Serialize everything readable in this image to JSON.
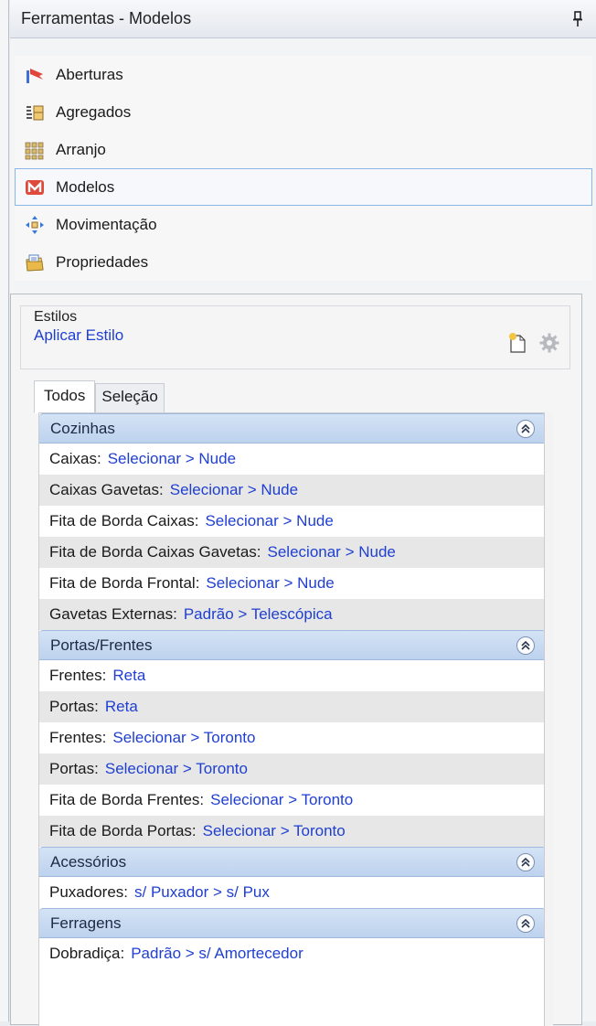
{
  "panel": {
    "title": "Ferramentas - Modelos"
  },
  "nav": [
    {
      "label": "Aberturas",
      "icon": "aberturas-icon"
    },
    {
      "label": "Agregados",
      "icon": "agregados-icon"
    },
    {
      "label": "Arranjo",
      "icon": "arranjo-icon"
    },
    {
      "label": "Modelos",
      "icon": "modelos-icon",
      "active": true
    },
    {
      "label": "Movimentação",
      "icon": "movimentacao-icon"
    },
    {
      "label": "Propriedades",
      "icon": "propriedades-icon"
    }
  ],
  "estilos": {
    "header": "Estilos",
    "link": "Aplicar Estilo"
  },
  "tabs": {
    "todos": "Todos",
    "selecao": "Seleção"
  },
  "groups": [
    {
      "title": "Cozinhas",
      "rows": [
        {
          "key": "Caixas:",
          "value": "Selecionar > Nude"
        },
        {
          "key": "Caixas Gavetas:",
          "value": "Selecionar > Nude"
        },
        {
          "key": "Fita de Borda Caixas:",
          "value": "Selecionar > Nude"
        },
        {
          "key": "Fita de Borda Caixas Gavetas:",
          "value": "Selecionar > Nude"
        },
        {
          "key": "Fita de Borda Frontal:",
          "value": "Selecionar > Nude"
        },
        {
          "key": "Gavetas Externas:",
          "value": "Padrão > Telescópica"
        }
      ]
    },
    {
      "title": "Portas/Frentes",
      "rows": [
        {
          "key": "Frentes:",
          "value": "Reta"
        },
        {
          "key": "Portas:",
          "value": "Reta"
        },
        {
          "key": "Frentes:",
          "value": "Selecionar > Toronto"
        },
        {
          "key": "Portas:",
          "value": "Selecionar > Toronto"
        },
        {
          "key": "Fita de Borda Frentes:",
          "value": "Selecionar > Toronto"
        },
        {
          "key": "Fita de Borda Portas:",
          "value": "Selecionar > Toronto"
        }
      ]
    },
    {
      "title": "Acessórios",
      "rows": [
        {
          "key": "Puxadores:",
          "value": "s/ Puxador > s/ Pux"
        }
      ]
    },
    {
      "title": "Ferragens",
      "rows": [
        {
          "key": "Dobradiça:",
          "value": "Padrão > s/ Amortecedor"
        }
      ]
    }
  ],
  "colors": {
    "link": "#1f3fd1",
    "group_header": "#c6d9f1",
    "active_border": "#8cb6e8"
  }
}
